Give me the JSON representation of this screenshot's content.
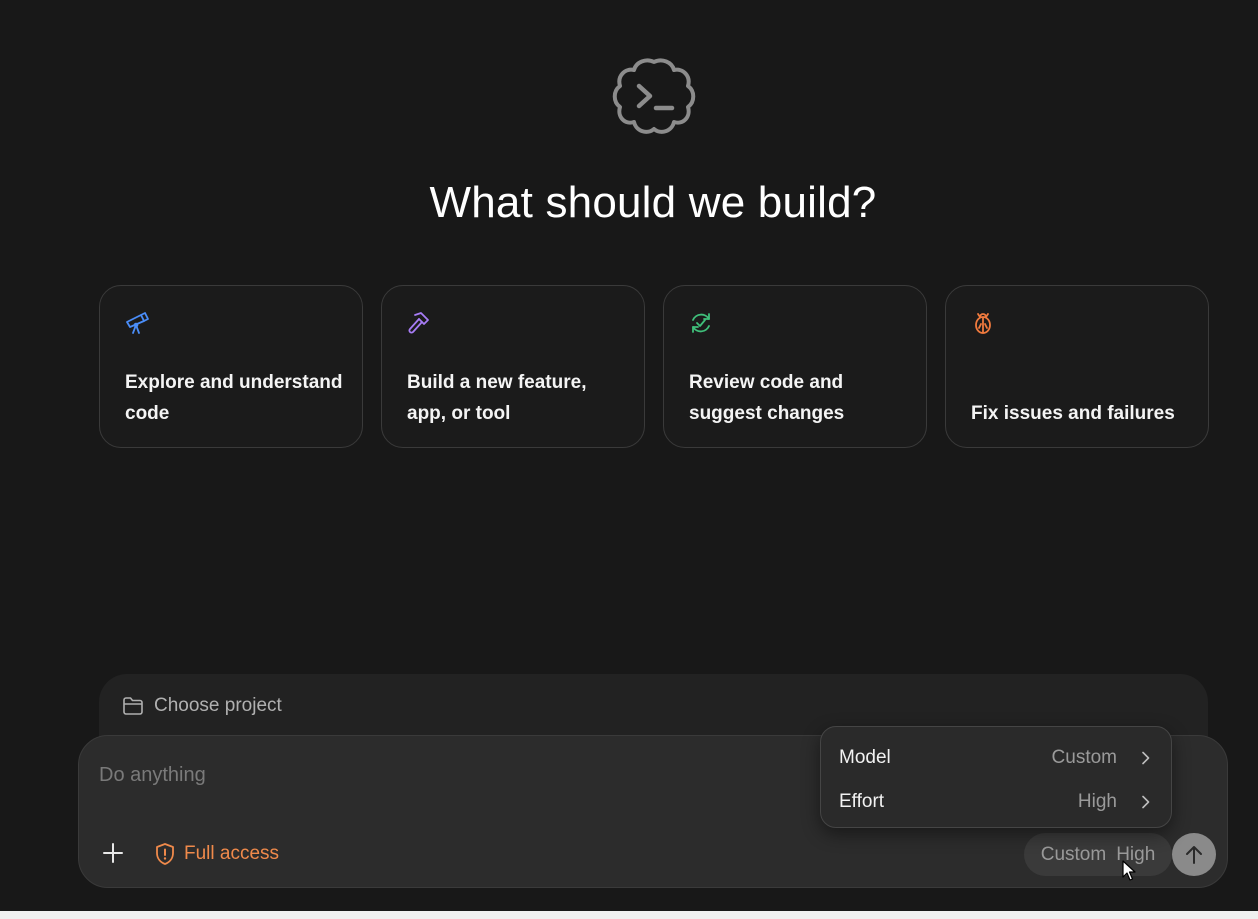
{
  "headline": "What should we build?",
  "cards": [
    {
      "label": "Explore and understand code",
      "icon": "telescope-icon",
      "color": "#4a8df8"
    },
    {
      "label": "Build a new feature, app, or tool",
      "icon": "hammer-icon",
      "color": "#a77cf5"
    },
    {
      "label": "Review code and suggest changes",
      "icon": "refresh-check-icon",
      "color": "#3fbf7a"
    },
    {
      "label": "Fix issues and failures",
      "icon": "bug-icon",
      "color": "#f07a3e"
    }
  ],
  "project": {
    "label": "Choose project",
    "icon": "folder-icon"
  },
  "composer": {
    "placeholder": "Do anything",
    "access_label": "Full access",
    "access_icon": "shield-alert-icon",
    "model_value": "Custom",
    "effort_value": "High"
  },
  "menu": {
    "items": [
      {
        "label": "Model",
        "value": "Custom"
      },
      {
        "label": "Effort",
        "value": "High"
      }
    ]
  },
  "colors": {
    "background": "#181818",
    "accent_orange": "#f08a4b",
    "card_border": "#3a3a3a"
  }
}
